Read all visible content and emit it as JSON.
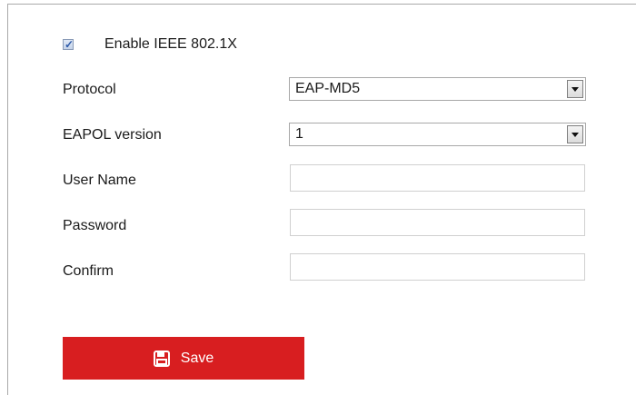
{
  "enable_8021x": {
    "label": "Enable IEEE 802.1X",
    "checked": true
  },
  "fields": {
    "protocol": {
      "label": "Protocol",
      "value": "EAP-MD5"
    },
    "eapol_version": {
      "label": "EAPOL version",
      "value": "1"
    },
    "user_name": {
      "label": "User Name",
      "value": ""
    },
    "password": {
      "label": "Password",
      "value": ""
    },
    "confirm": {
      "label": "Confirm",
      "value": ""
    }
  },
  "save_button": {
    "label": "Save",
    "icon": "save-icon"
  },
  "colors": {
    "accent": "#d81e20",
    "checkbox_tick": "#2d5aa8"
  }
}
